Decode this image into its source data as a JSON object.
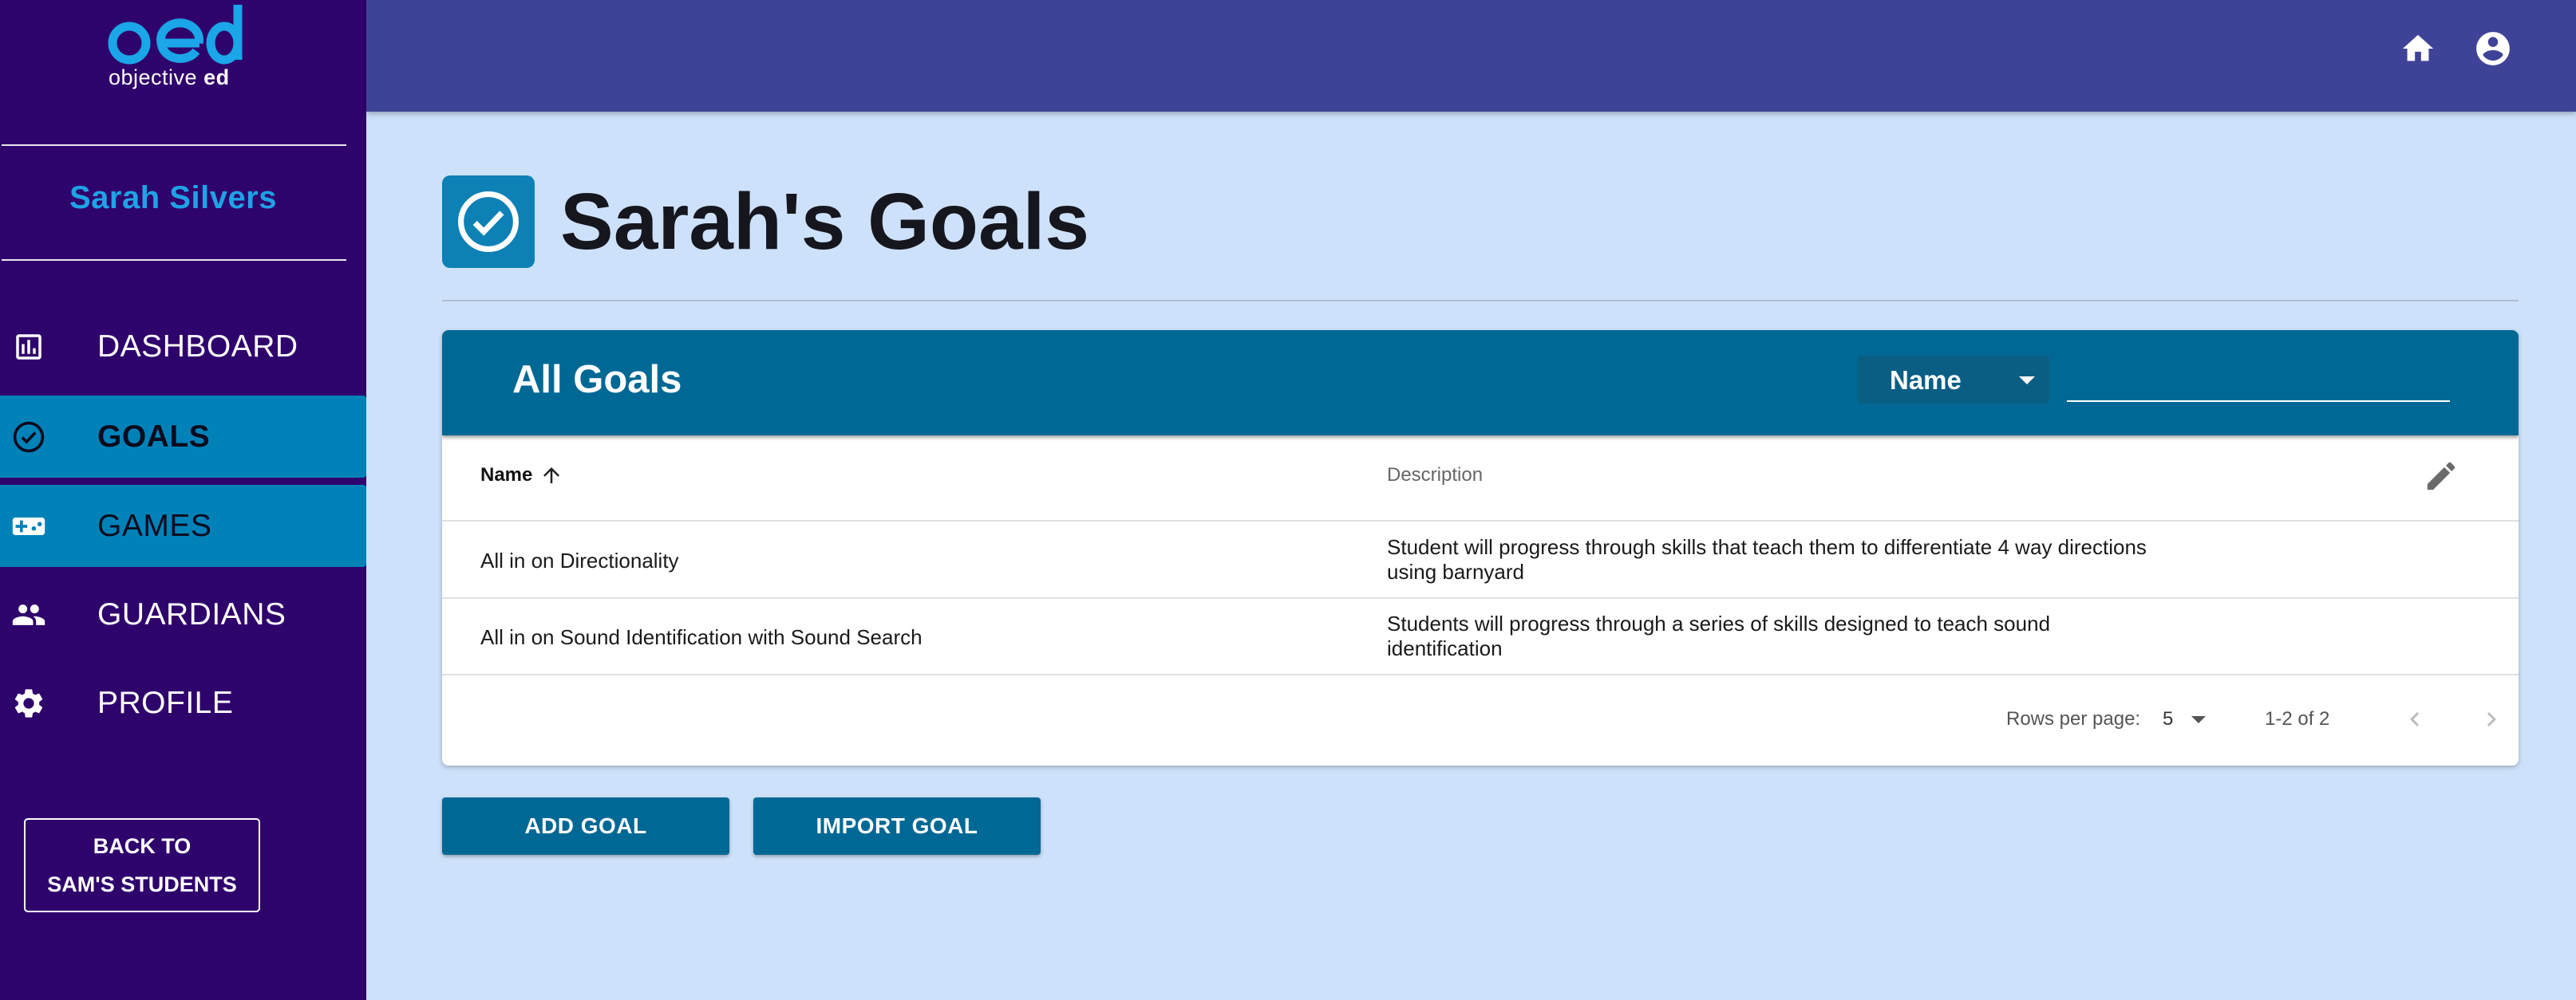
{
  "brand": {
    "mark": "oed",
    "text_regular": "objective ",
    "text_bold": "ed"
  },
  "sidebar": {
    "user_name": "Sarah Silvers",
    "items": [
      {
        "label": "DASHBOARD",
        "icon": "dashboard-icon",
        "active": false
      },
      {
        "label": "GOALS",
        "icon": "check-circle-icon",
        "active": true
      },
      {
        "label": "GAMES",
        "icon": "gamepad-icon",
        "active": true
      },
      {
        "label": "GUARDIANS",
        "icon": "people-icon",
        "active": false
      },
      {
        "label": "PROFILE",
        "icon": "gear-icon",
        "active": false
      }
    ],
    "back_button": {
      "line1": "BACK TO",
      "line2": "SAM'S STUDENTS"
    }
  },
  "topbar": {
    "icons": [
      "home-icon",
      "account-circle-icon"
    ]
  },
  "page": {
    "title": "Sarah's Goals",
    "icon": "check-circle-icon"
  },
  "card": {
    "title": "All Goals",
    "filter": {
      "selected": "Name"
    },
    "search": {
      "value": "",
      "placeholder": ""
    },
    "columns": [
      {
        "label": "Name",
        "sort": "ascending"
      },
      {
        "label": "Description"
      }
    ],
    "rows": [
      {
        "name": "All in on Directionality",
        "description_lines": [
          "Student will progress through skills that teach them to differentiate 4 way directions",
          "using barnyard"
        ]
      },
      {
        "name": "All in on Sound Identification with Sound Search",
        "description_lines": [
          "Students will progress through a series of skills designed to teach sound",
          "identification"
        ]
      }
    ],
    "footer": {
      "rows_per_page_label": "Rows per page:",
      "rows_per_page_value": "5",
      "range": "1-2 of 2"
    }
  },
  "actions": {
    "add": "ADD GOAL",
    "import": "IMPORT GOAL"
  },
  "colors": {
    "sidebar_bg": "#2f036c",
    "topbar_bg": "#3f4397",
    "content_bg": "#cde1fa",
    "accent": "#006894",
    "active_nav": "#0082b8",
    "user_name": "#1fa3e6"
  }
}
